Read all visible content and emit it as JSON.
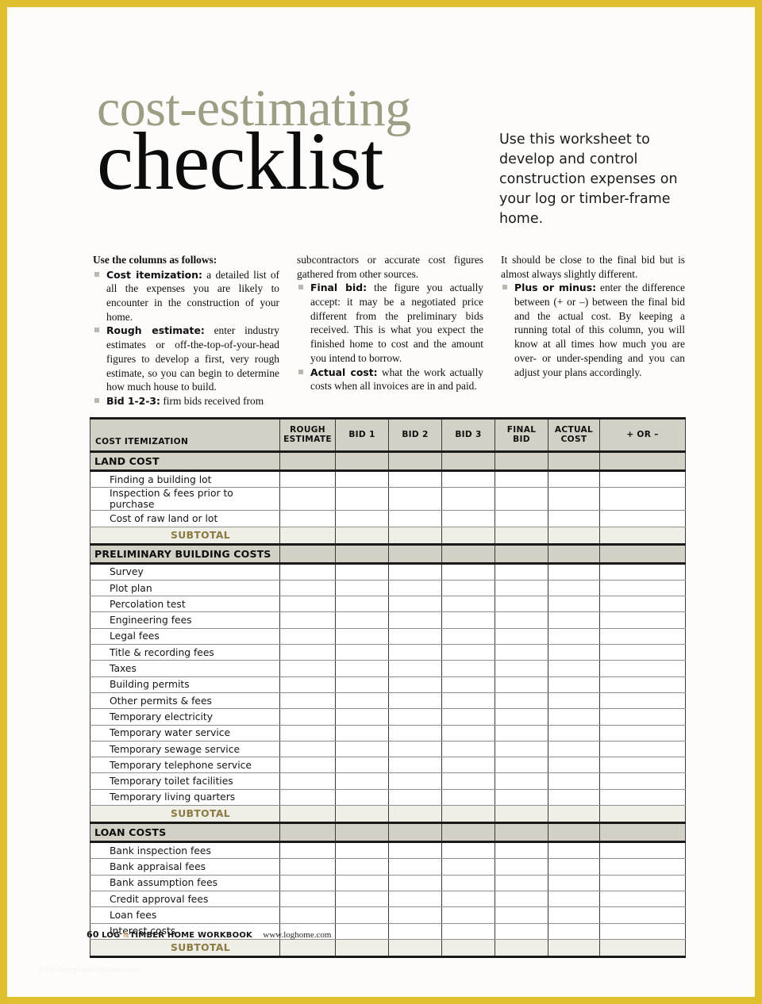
{
  "page": {
    "border_color": "#e0c02e",
    "background": "#fdfcfb"
  },
  "masthead": {
    "title_line1": "cost-estimating",
    "title_line2": "checklist",
    "title_line1_color": "#9d9e84",
    "title_line2_color": "#0c0c0c",
    "deck": "Use this worksheet to develop and control construction expenses on your log or timber-frame home."
  },
  "intro": {
    "heading": "Use the columns as follows:",
    "column1": [
      {
        "lead": "Cost itemization:",
        "text": " a detailed list of all the expenses you are likely to encounter in the construction of your home."
      },
      {
        "lead": "Rough estimate:",
        "text": " enter industry estimates or off-the-top-of-your-head figures to develop a first, very rough estimate, so you can begin to determine how much house to build."
      },
      {
        "lead": "Bid 1-2-3:",
        "text": " firm bids received from"
      }
    ],
    "column2_continuation": "subcontractors or accurate cost figures gathered from other sources.",
    "column2": [
      {
        "lead": "Final bid:",
        "text": " the figure you actually accept: it may be a negotiated price different from the preliminary bids received. This is what you expect the finished home to cost and the amount you intend to borrow."
      },
      {
        "lead": "Actual cost:",
        "text": " what the work actually costs when all invoices are in and paid."
      }
    ],
    "column3_continuation": "It should be close to the final bid but is almost always slightly different.",
    "column3": [
      {
        "lead": "Plus or minus:",
        "text": " enter the difference between (+ or –) between the final bid and the actual cost. By keeping a running total of this column, you will know at all times how much you are over- or under-spending and you can adjust your plans accordingly."
      }
    ]
  },
  "table": {
    "columns": [
      {
        "label": "COST ITEMIZATION",
        "key": "item"
      },
      {
        "label": "ROUGH ESTIMATE",
        "line1": "ROUGH",
        "line2": "ESTIMATE",
        "key": "rough"
      },
      {
        "label": "BID 1",
        "key": "bid1"
      },
      {
        "label": "BID 2",
        "key": "bid2"
      },
      {
        "label": "BID 3",
        "key": "bid3"
      },
      {
        "label": "FINAL BID",
        "line1": "FINAL",
        "line2": "BID",
        "key": "final"
      },
      {
        "label": "ACTUAL COST",
        "line1": "ACTUAL",
        "line2": "COST",
        "key": "actual"
      },
      {
        "label": "+ OR –",
        "key": "plusminus"
      }
    ],
    "subtotal_label": "SUBTOTAL",
    "subtotal_color": "#8a7a42",
    "header_bg": "#d3d1c5",
    "sections": [
      {
        "title": "LAND COST",
        "items": [
          "Finding a building lot",
          "Inspection & fees prior to purchase",
          "Cost of raw land or lot"
        ]
      },
      {
        "title": "PRELIMINARY BUILDING COSTS",
        "items": [
          "Survey",
          "Plot plan",
          "Percolation test",
          "Engineering fees",
          "Legal fees",
          "Title & recording fees",
          "Taxes",
          "Building permits",
          "Other permits & fees",
          "Temporary electricity",
          "Temporary water service",
          "Temporary sewage service",
          "Temporary telephone service",
          "Temporary toilet facilities",
          "Temporary living quarters"
        ]
      },
      {
        "title": "LOAN COSTS",
        "items": [
          "Bank inspection fees",
          "Bank appraisal fees",
          "Bank assumption fees",
          "Credit approval fees",
          "Loan fees",
          "Interest costs"
        ]
      }
    ]
  },
  "footer": {
    "page_number": "60",
    "publication_part1": "LOG",
    "publication_amp": "&",
    "publication_part2": "TIMBER HOME WORKBOOK",
    "url": "www.loghome.com"
  },
  "watermark": {
    "text": "free-template-download"
  }
}
